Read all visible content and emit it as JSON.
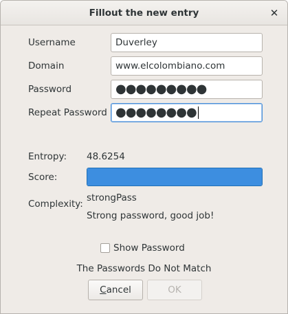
{
  "window": {
    "title": "Fillout the new entry"
  },
  "form": {
    "username": {
      "label": "Username",
      "value": "Duverley"
    },
    "domain": {
      "label": "Domain",
      "value": "www.elcolombiano.com"
    },
    "password": {
      "label": "Password",
      "masked": "●●●●●●●●●"
    },
    "repeat_password": {
      "label": "Repeat Password",
      "masked": "●●●●●●●●"
    }
  },
  "strength": {
    "entropy_label": "Entropy:",
    "entropy_value": "48.6254",
    "score_label": "Score:",
    "score_fraction": 1.0,
    "complexity_label": "Complexity:",
    "complexity_value": "strongPass",
    "message": "Strong password, good job!"
  },
  "show_password": {
    "label": "Show Password",
    "checked": false
  },
  "status": "The Passwords Do Not Match",
  "buttons": {
    "cancel_first": "C",
    "cancel_rest": "ancel",
    "ok": "OK"
  },
  "colors": {
    "score_fill": "#3d8ee0",
    "focus_border": "#4a90d9"
  }
}
